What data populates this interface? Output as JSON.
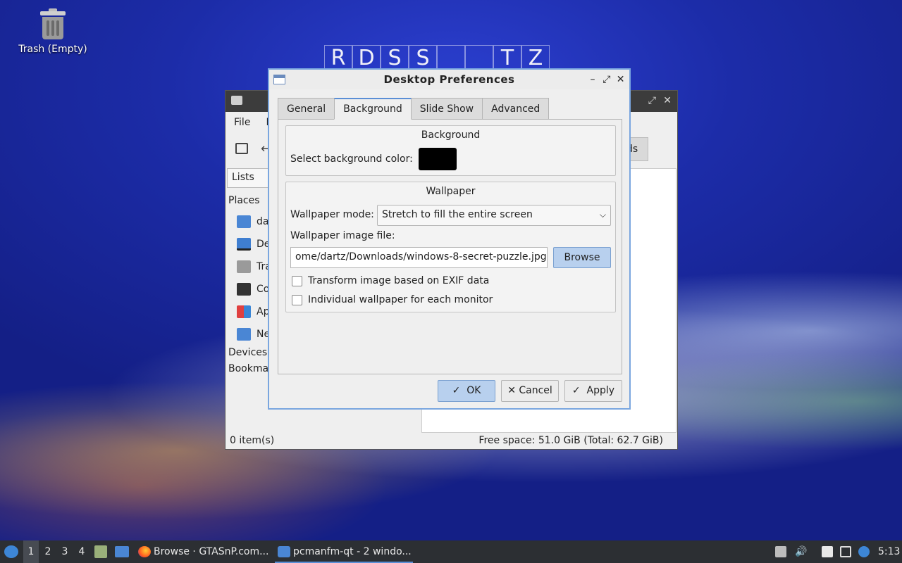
{
  "desktop": {
    "trash_label": "Trash (Empty)",
    "puzzle_letters": [
      "R",
      "D",
      "S",
      "S",
      "",
      "",
      "T",
      "Z"
    ]
  },
  "file_manager": {
    "menu": [
      "File",
      "E"
    ],
    "side_tab": "Lists",
    "places_header": "Places",
    "places": [
      {
        "label": "da",
        "icon": "home-folder-icon"
      },
      {
        "label": "De",
        "icon": "desktop-icon"
      },
      {
        "label": "Tra",
        "icon": "trash-icon"
      },
      {
        "label": "Co",
        "icon": "computer-icon"
      },
      {
        "label": "Ap",
        "icon": "applications-icon"
      },
      {
        "label": "Ne",
        "icon": "network-icon"
      }
    ],
    "devices_header": "Devices",
    "bookmarks_header": "Bookmarks",
    "downloads_button": "ds",
    "status_left": "0 item(s)",
    "status_right": "Free space: 51.0 GiB (Total: 62.7 GiB)"
  },
  "dialog": {
    "title": "Desktop Preferences",
    "controls": {
      "minimize": "–",
      "maximize": "⤢",
      "close": "✕"
    },
    "tabs": [
      "General",
      "Background",
      "Slide Show",
      "Advanced"
    ],
    "active_tab": "Background",
    "background_group": {
      "title": "Background",
      "color_label": "Select background color:",
      "color_value": "#000000"
    },
    "wallpaper_group": {
      "title": "Wallpaper",
      "mode_label": "Wallpaper mode:",
      "mode_value": "Stretch to fill the entire screen",
      "file_label": "Wallpaper image file:",
      "file_value": "ome/dartz/Downloads/windows-8-secret-puzzle.jpg",
      "browse_label": "Browse",
      "exif_label": "Transform image based on EXIF data",
      "exif_checked": false,
      "per_monitor_label": "Individual wallpaper for each monitor",
      "per_monitor_checked": false
    },
    "buttons": {
      "ok": "OK",
      "cancel": "Cancel",
      "apply": "Apply"
    }
  },
  "taskbar": {
    "desktops": [
      "1",
      "2",
      "3",
      "4"
    ],
    "active_desktop": "1",
    "tasks": [
      {
        "label": "Browse · GTASnP.com...",
        "icon": "firefox-icon"
      },
      {
        "label": "pcmanfm-qt - 2 windo...",
        "icon": "folder-icon"
      }
    ],
    "clock": "5:13"
  },
  "colors": {
    "accent": "#5b8fd6",
    "button_primary": "#b8d0ee",
    "taskbar": "#2c2f33"
  }
}
